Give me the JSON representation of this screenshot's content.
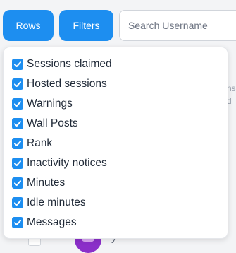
{
  "toolbar": {
    "rows_label": "Rows",
    "filters_label": "Filters",
    "search_placeholder": "Search Username",
    "accent_color": "#1d8ef0"
  },
  "background": {
    "fragment_1": "ns",
    "fragment_2": "d",
    "fragment_3": "y"
  },
  "filters_menu": {
    "items": [
      {
        "label": "Sessions claimed",
        "checked": true
      },
      {
        "label": "Hosted sessions",
        "checked": true
      },
      {
        "label": "Warnings",
        "checked": true
      },
      {
        "label": "Wall Posts",
        "checked": true
      },
      {
        "label": "Rank",
        "checked": true
      },
      {
        "label": "Inactivity notices",
        "checked": true
      },
      {
        "label": "Minutes",
        "checked": true
      },
      {
        "label": "Idle minutes",
        "checked": true
      },
      {
        "label": "Messages",
        "checked": true
      }
    ],
    "checkbox_icon": "checkmark-icon"
  }
}
